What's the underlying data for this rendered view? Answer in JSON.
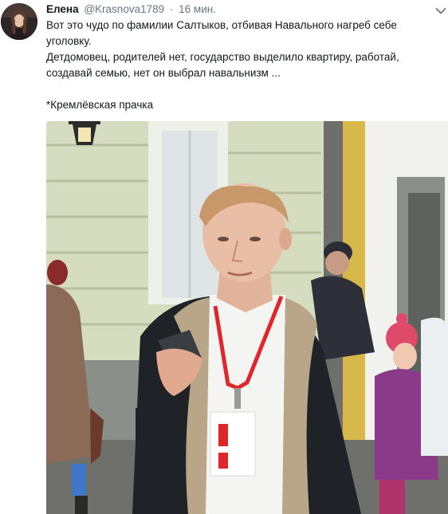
{
  "tweet": {
    "display_name": "Елена",
    "handle": "@Krasnova1789",
    "separator": "·",
    "time": "16 мин.",
    "text_line_1": "Вот это чудо по фамилии Салтыков, отбивая Навального нагреб себе",
    "text_line_2": "уголовку.",
    "text_line_3": "Детдомовец, родителей нет, государство выделило квартиру, работай,",
    "text_line_4": "создавай семью, нет он выбрал навальнизм ...",
    "text_line_5": "*Кремлёвская прачка"
  },
  "icons": {
    "caret": "chevron-down-icon"
  },
  "colors": {
    "text": "#14171a",
    "secondary": "#657786",
    "lanyard": "#e0262a"
  }
}
